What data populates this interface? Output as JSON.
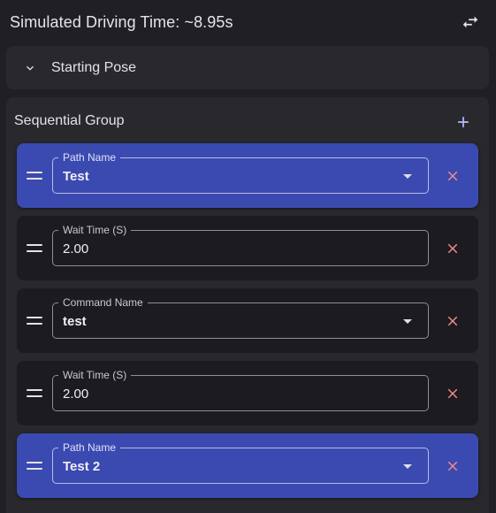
{
  "header": {
    "title": "Simulated Driving Time: ~8.95s",
    "swap_icon": "swap-horiz-icon"
  },
  "starting_pose": {
    "label": "Starting Pose",
    "expanded": false
  },
  "group": {
    "title": "Sequential Group",
    "add_icon": "add-icon"
  },
  "colors": {
    "selected_card": "#3a4ab0",
    "card": "#1c1b1f",
    "close": "#f28b8b",
    "accent": "#b7c0ff"
  },
  "commands": [
    {
      "type": "path",
      "label": "Path Name",
      "value": "Test",
      "selected": true
    },
    {
      "type": "wait",
      "label": "Wait Time (S)",
      "value": "2.00",
      "selected": false
    },
    {
      "type": "named",
      "label": "Command Name",
      "value": "test",
      "selected": false
    },
    {
      "type": "wait",
      "label": "Wait Time (S)",
      "value": "2.00",
      "selected": false
    },
    {
      "type": "path",
      "label": "Path Name",
      "value": "Test 2",
      "selected": true
    }
  ]
}
